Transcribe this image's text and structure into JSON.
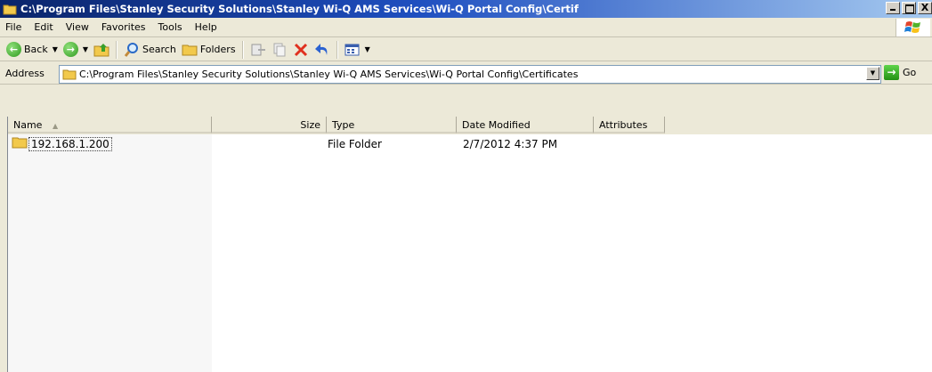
{
  "window": {
    "title": "C:\\Program Files\\Stanley Security Solutions\\Stanley Wi-Q AMS Services\\Wi-Q Portal Config\\Certif",
    "controls": {
      "minimize": "_",
      "maximize": "□",
      "close": "X"
    }
  },
  "menu": [
    {
      "label": "File"
    },
    {
      "label": "Edit"
    },
    {
      "label": "View"
    },
    {
      "label": "Favorites"
    },
    {
      "label": "Tools"
    },
    {
      "label": "Help"
    }
  ],
  "toolbar": {
    "back_label": "Back",
    "search_label": "Search",
    "folders_label": "Folders"
  },
  "address": {
    "label": "Address",
    "value": "C:\\Program Files\\Stanley Security Solutions\\Stanley Wi-Q AMS Services\\Wi-Q Portal Config\\Certificates",
    "go_label": "Go"
  },
  "list": {
    "columns": [
      {
        "label": "Name",
        "sorted": true
      },
      {
        "label": "Size"
      },
      {
        "label": "Type"
      },
      {
        "label": "Date Modified"
      },
      {
        "label": "Attributes"
      }
    ],
    "rows": [
      {
        "name": "192.168.1.200",
        "size": "",
        "type": "File Folder",
        "date_modified": "2/7/2012 4:37 PM",
        "attributes": ""
      }
    ]
  },
  "colors": {
    "title_start": "#0a246a",
    "title_end": "#a6caf0",
    "chrome": "#ece9d8",
    "folder": "#f2c94c"
  }
}
